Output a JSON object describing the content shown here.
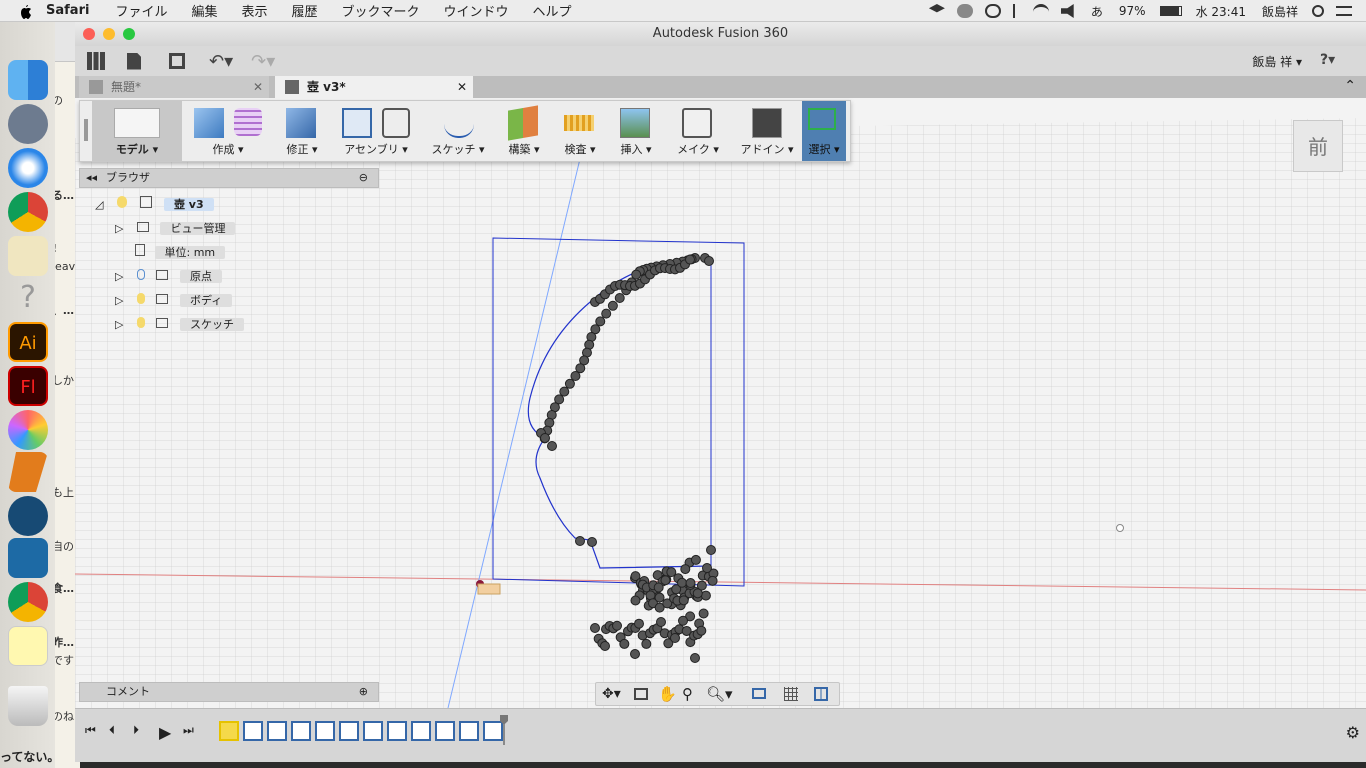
{
  "menubar": {
    "app": "Safari",
    "items": [
      "ファイル",
      "編集",
      "表示",
      "履歴",
      "ブックマーク",
      "ウインドウ",
      "ヘルプ"
    ],
    "battery": "97%",
    "ime": "あ",
    "clock": "水 23:41",
    "user": "飯島祥"
  },
  "window": {
    "title": "Autodesk Fusion 360",
    "user_label": "飯島 祥 ▾",
    "tabs": [
      {
        "label": "無題*"
      },
      {
        "label": "壺 v3*"
      }
    ]
  },
  "toolbar": {
    "workspace": "モデル ▾",
    "groups": [
      "作成 ▾",
      "修正 ▾",
      "アセンブリ ▾",
      "スケッチ ▾",
      "構築 ▾",
      "検査 ▾",
      "挿入 ▾",
      "メイク ▾",
      "アドイン ▾",
      "選択 ▾"
    ]
  },
  "browser": {
    "title": "ブラウザ",
    "root": "壺 v3",
    "items": [
      "ビュー管理",
      "単位: mm",
      "原点",
      "ボディ",
      "スケッチ"
    ]
  },
  "viewcube": {
    "face": "前"
  },
  "comment": {
    "label": "コメント"
  },
  "page": {
    "snippets": [
      "の",
      "る…",
      "!",
      "leav",
      "、…",
      "しか",
      "も上",
      "自の",
      "食…",
      "昨…",
      "です",
      "のね"
    ],
    "bottom": "ってない。",
    "url": "dp00000116.shop-pro.jp"
  },
  "colors": {
    "accent": "#3b6ea5",
    "sketch": "#1a1acc",
    "dot": "#555555"
  }
}
